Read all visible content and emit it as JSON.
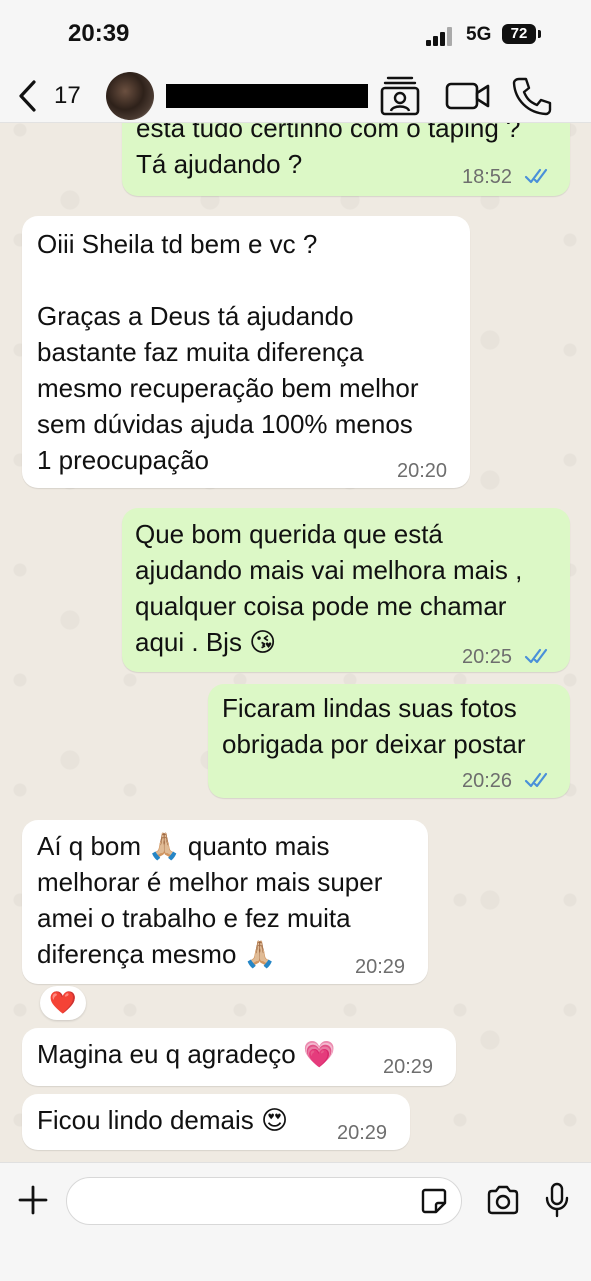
{
  "status": {
    "time": "20:39",
    "network": "5G",
    "battery": "72"
  },
  "header": {
    "back_count": "17"
  },
  "messages": [
    {
      "dir": "out",
      "text": "está tudo certinho com o taping ?\nTá ajudando ?",
      "time": "18:52"
    },
    {
      "dir": "in",
      "text": "Oiii Sheila td bem e vc ?\n\nGraças a Deus tá ajudando\nbastante faz muita diferença\nmesmo recuperação bem melhor\nsem dúvidas ajuda 100% menos\n1 preocupação",
      "time": "20:20"
    },
    {
      "dir": "out",
      "text": "Que bom querida que está\najudando mais vai melhora mais ,\nqualquer coisa pode me chamar\naqui . Bjs 😘",
      "time": "20:25"
    },
    {
      "dir": "out",
      "text": "Ficaram lindas suas fotos\nobrigada por deixar postar",
      "time": "20:26"
    },
    {
      "dir": "in",
      "text": "Aí q bom 🙏🏼 quanto mais\nmelhorar é melhor mais super\namei o trabalho e fez muita\ndiferença mesmo 🙏🏼",
      "time": "20:29"
    },
    {
      "dir": "in",
      "text": "Magina eu q agradeço 💗",
      "time": "20:29"
    },
    {
      "dir": "in",
      "text": "Ficou lindo demais 😍",
      "time": "20:29"
    }
  ],
  "reaction": "❤️",
  "composer": {
    "placeholder": ""
  },
  "icons": {
    "back": "chevron-left-icon",
    "contact_card": "contact-card-icon",
    "video": "video-call-icon",
    "call": "phone-icon",
    "plus": "plus-icon",
    "sticker": "sticker-icon",
    "camera": "camera-icon",
    "mic": "microphone-icon",
    "read": "double-check-icon"
  },
  "colors": {
    "outgoing": "#dcf8c6",
    "incoming": "#ffffff",
    "read_ticks": "#4a90d9"
  }
}
